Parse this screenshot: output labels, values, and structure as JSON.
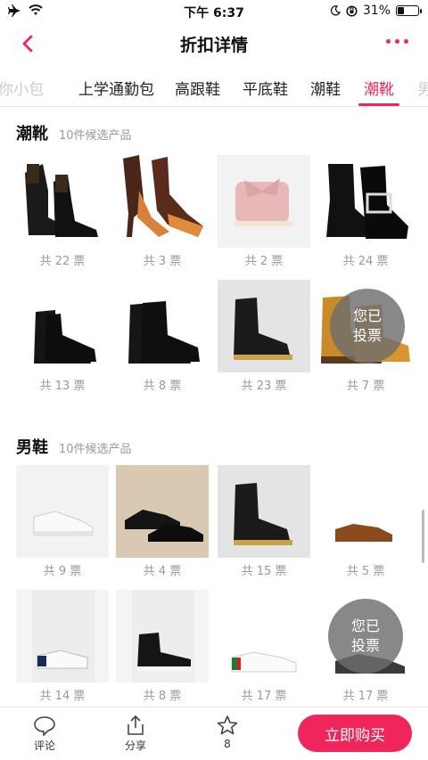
{
  "status_bar": {
    "time": "下午 6:37",
    "battery": "31%",
    "battery_level": 0.31
  },
  "nav": {
    "title": "折扣详情"
  },
  "tabs": [
    "你小包",
    "上学通勤包",
    "高跟鞋",
    "平底鞋",
    "潮鞋",
    "潮靴",
    "男"
  ],
  "active_tab": "潮靴",
  "sections": [
    {
      "title": "潮靴",
      "subtitle": "10件候选产品",
      "products": [
        {
          "votes": "共 22 票",
          "voted": false,
          "icon": "black-lace-up-boot"
        },
        {
          "votes": "共 3 票",
          "voted": false,
          "icon": "brown-orange-heeled-boot"
        },
        {
          "votes": "共 2 票",
          "voted": false,
          "icon": "pink-bow-ugg-boot"
        },
        {
          "votes": "共 24 票",
          "voted": false,
          "icon": "black-patent-buckle-boot"
        },
        {
          "votes": "共 13 票",
          "voted": false,
          "icon": "black-chelsea-boot"
        },
        {
          "votes": "共 8 票",
          "voted": false,
          "icon": "black-combat-boot"
        },
        {
          "votes": "共 23 票",
          "voted": false,
          "icon": "dr-martens-boot"
        },
        {
          "votes": "共 7 票",
          "voted": true,
          "icon": "timberland-boot"
        }
      ]
    },
    {
      "title": "男鞋",
      "subtitle": "10件候选产品",
      "products": [
        {
          "votes": "共 9 票",
          "voted": false,
          "icon": "white-sneaker"
        },
        {
          "votes": "共 4 票",
          "voted": false,
          "icon": "black-brogue"
        },
        {
          "votes": "共 15 票",
          "voted": false,
          "icon": "dr-martens-boot"
        },
        {
          "votes": "共 5 票",
          "voted": false,
          "icon": "brown-oxford"
        },
        {
          "votes": "共 14 票",
          "voted": false,
          "icon": "white-navy-sneaker"
        },
        {
          "votes": "共 8 票",
          "voted": false,
          "icon": "black-high-top"
        },
        {
          "votes": "共 17 票",
          "voted": false,
          "icon": "gucci-bee-sneaker"
        },
        {
          "votes": "共 17 票",
          "voted": true,
          "icon": "grey-knit-sneaker"
        }
      ]
    }
  ],
  "voted_badge": {
    "line1": "您已",
    "line2": "投票"
  },
  "bottom_bar": {
    "comment_label": "评论",
    "share_label": "分享",
    "favorite_count": "8",
    "buy_label": "立即购买"
  },
  "colors": {
    "accent": "#f0255b"
  }
}
